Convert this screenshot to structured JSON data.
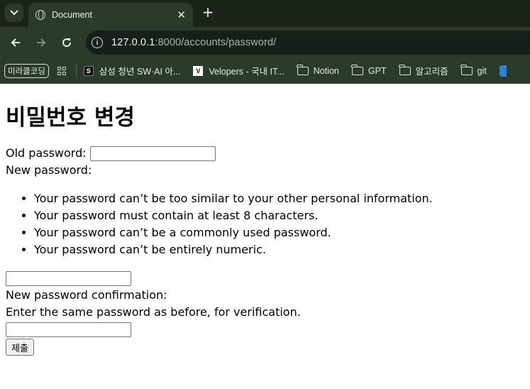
{
  "browser": {
    "tab_title": "Document",
    "tab_close": "✕",
    "new_tab": "+",
    "url_host": "127.0.0.1",
    "url_rest": ":8000/accounts/password/",
    "bookmarks": [
      {
        "label": "미라클코딩",
        "icon": "pill"
      },
      {
        "label": "삼성 청년 SW·AI 아...",
        "icon": "favicon-s"
      },
      {
        "label": "Velopers - 국내 IT...",
        "icon": "favicon-v"
      },
      {
        "label": "Notion",
        "icon": "folder-icon"
      },
      {
        "label": "GPT",
        "icon": "folder-icon"
      },
      {
        "label": "알고리즘",
        "icon": "folder-icon"
      },
      {
        "label": "git",
        "icon": "folder-icon"
      }
    ]
  },
  "page": {
    "title": "비밀번호 변경",
    "old_password_label": "Old password:",
    "new_password_label": "New password:",
    "help_items": [
      "Your password can’t be too similar to your other personal information.",
      "Your password must contain at least 8 characters.",
      "Your password can’t be a commonly used password.",
      "Your password can’t be entirely numeric."
    ],
    "confirm_label": "New password confirmation:",
    "confirm_help": "Enter the same password as before, for verification.",
    "submit_label": "제출"
  }
}
